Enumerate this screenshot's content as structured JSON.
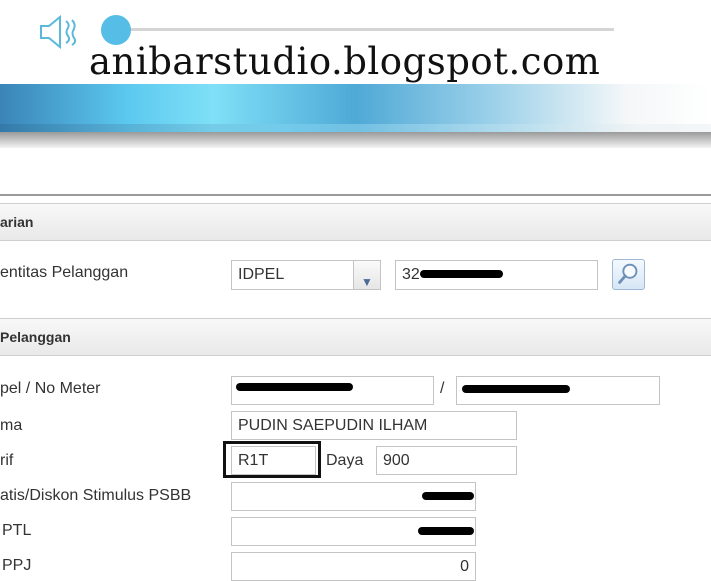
{
  "watermark": "anibarstudio.blogspot.com",
  "player": {
    "speaker_icon": "speaker-muted-icon",
    "progress": 0.0
  },
  "sections": {
    "search": {
      "title": "arian"
    },
    "customer": {
      "title": "Pelanggan"
    }
  },
  "search": {
    "label": "entitas Pelanggan",
    "type_value": "IDPEL",
    "query_prefix": "32",
    "button_icon": "magnifier-icon"
  },
  "customer": {
    "idpel_label": "pel / No Meter",
    "separator": "/",
    "name_label": "ma",
    "name_value": "PUDIN SAEPUDIN ILHAM",
    "tarif_label": "rif",
    "tarif_value": "R1T",
    "daya_label": "Daya",
    "daya_value": "900",
    "diskon_label": "atis/Diskon Stimulus PSBB",
    "ptl_label": "PTL",
    "ppj_label": "PPJ",
    "ppj_value": "0"
  },
  "colors": {
    "accent": "#55bde6",
    "banner": "#5cc9ef"
  }
}
